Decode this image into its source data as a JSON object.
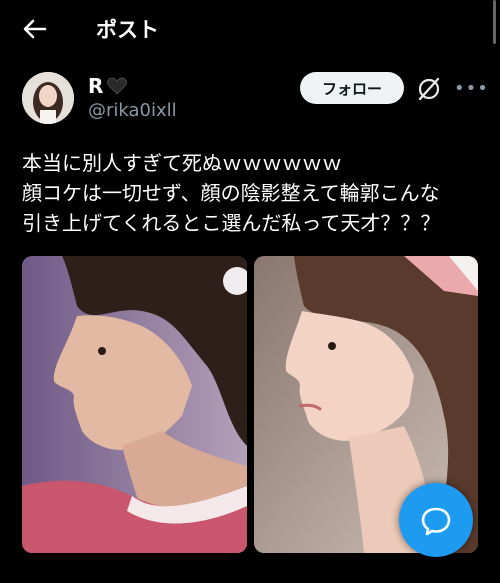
{
  "header": {
    "title": "ポスト"
  },
  "post": {
    "author_name": "R",
    "author_handle": "@rika0ixll",
    "follow_label": "フォロー",
    "text_lines": [
      "本当に別人すぎて死ぬｗｗｗｗｗｗ",
      "顔コケは一切せず、顔の陰影整えて輪郭こんな",
      "引き上げてくれるとこ選んだ私って天才？？？"
    ],
    "images": [
      {
        "desc": "before-side-profile"
      },
      {
        "desc": "after-side-profile"
      }
    ]
  },
  "colors": {
    "accent": "#1d9bf0",
    "bg": "#000000",
    "secondary_text": "#8b98a5"
  },
  "icons": [
    "back-arrow-icon",
    "black-heart-icon",
    "grok-icon",
    "more-icon",
    "compose-reply-icon"
  ]
}
